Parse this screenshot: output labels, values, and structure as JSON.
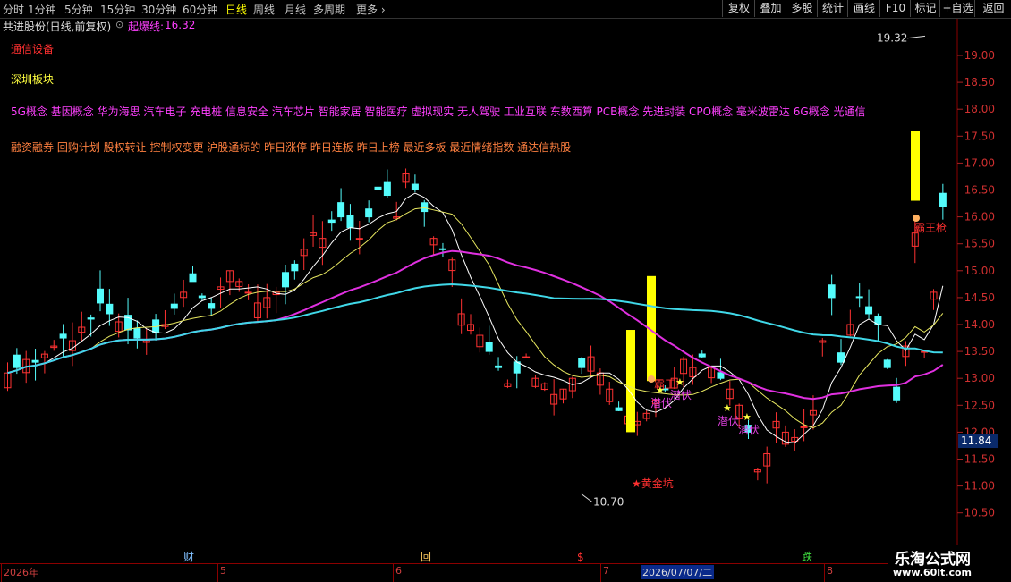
{
  "toolbar": {
    "periods": [
      "分时",
      "1分钟",
      "5分钟",
      "15分钟",
      "30分钟",
      "60分钟",
      "日线",
      "周线",
      "月线",
      "多周期",
      "更多"
    ],
    "active_period": "日线",
    "tools": [
      "复权",
      "叠加",
      "多股",
      "统计",
      "画线",
      "F10",
      "标记",
      "+自选",
      "返回"
    ]
  },
  "stock": {
    "title": "共进股份(日线,前复权)",
    "indicator_name": "起爆线:",
    "indicator_value": "16.32"
  },
  "tags": {
    "industry": "通信设备",
    "region": "深圳板块",
    "concepts": "5G概念 基因概念 华为海思 汽车电子 充电桩 信息安全 汽车芯片 智能家居 智能医疗 虚拟现实 无人驾驶 工业互联 东数西算 PCB概念 先进封装 CPO概念 毫米波雷达 6G概念 光通信",
    "styles": "融资融券 回购计划 股权转让 控制权变更 沪股通标的 昨日涨停 昨日连板 昨日上榜 最近多板 最近情绪指数 通达信热股"
  },
  "chart_data": {
    "type": "candlestick",
    "y_axis": {
      "ticks": [
        "19.00",
        "18.50",
        "18.00",
        "17.50",
        "17.00",
        "16.50",
        "16.00",
        "15.50",
        "15.00",
        "14.50",
        "14.00",
        "13.50",
        "13.00",
        "12.50",
        "12.00",
        "11.50",
        "11.00",
        "10.50"
      ],
      "current_price": "11.84"
    },
    "high_label": "19.32",
    "low_label": "10.70",
    "signals": [
      {
        "text": "潜伏",
        "color": "#e040e0"
      },
      {
        "text": "潜伏",
        "color": "#e040e0"
      },
      {
        "text": "潜伏",
        "color": "#e040e0"
      },
      {
        "text": "潜伏",
        "color": "#e040e0"
      },
      {
        "text": "★黄金坑",
        "color": "#ff3030"
      },
      {
        "text": "霸王枪",
        "color": "#ff3030"
      },
      {
        "text": "霸王",
        "color": "#ff3030"
      }
    ],
    "event_markers": [
      "财",
      "回",
      "$",
      "跌"
    ],
    "date_labels": [
      "2026年",
      "5",
      "6",
      "7",
      "2026/07/07/二",
      "8"
    ],
    "colors": {
      "up": "#ff3232",
      "down": "#54fcfc",
      "signal_bar": "#ffff00",
      "ma_white": "#ffffff",
      "ma_yellow": "#e8e860",
      "ma_cyan": "#40d8e8",
      "ma_magenta": "#e030e0"
    }
  },
  "watermark": {
    "line1": "乐淘公式网",
    "line2": "www.60lt.com"
  }
}
